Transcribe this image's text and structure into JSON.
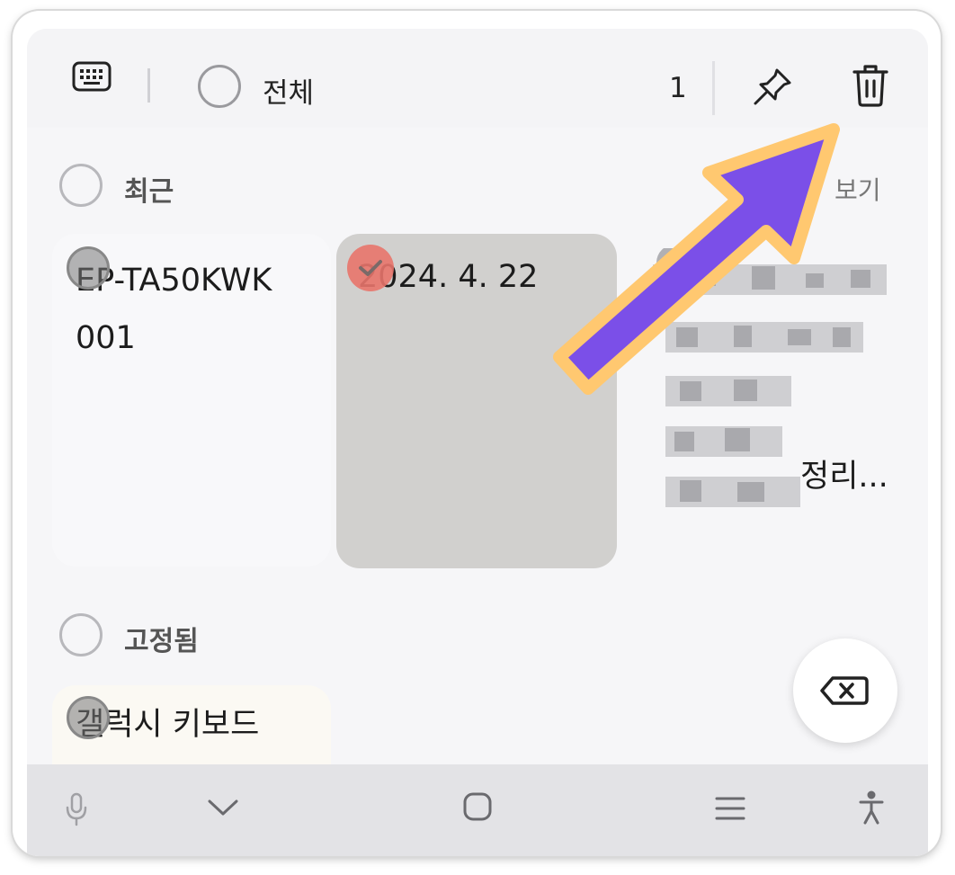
{
  "toolbar": {
    "keyboard_icon": "keyboard-icon",
    "select_all_label": "전체",
    "selected_count": "1",
    "pin_icon": "pin-icon",
    "delete_icon": "trash-icon"
  },
  "sections": {
    "recent": {
      "label": "최근",
      "view_all": "보기"
    },
    "pinned": {
      "label": "고정됨"
    }
  },
  "notes": {
    "note1": {
      "text": "EP-TA50KWK\n001"
    },
    "note2": {
      "text": "2024. 4. 22",
      "selected": true
    },
    "note3": {
      "text": "정리..."
    },
    "note4": {
      "text": "갤럭시 키보드\n상단에는 툴바"
    }
  },
  "fab": {
    "icon": "backspace-icon"
  },
  "navbar": {
    "icons": [
      "mic-icon",
      "chevron-down-icon",
      "home-icon",
      "menu-icon",
      "accessibility-icon"
    ]
  },
  "colors": {
    "accent_arrow_fill": "#7b4fe8",
    "accent_arrow_stroke": "#ffc870",
    "selected_check": "#e8746c"
  }
}
